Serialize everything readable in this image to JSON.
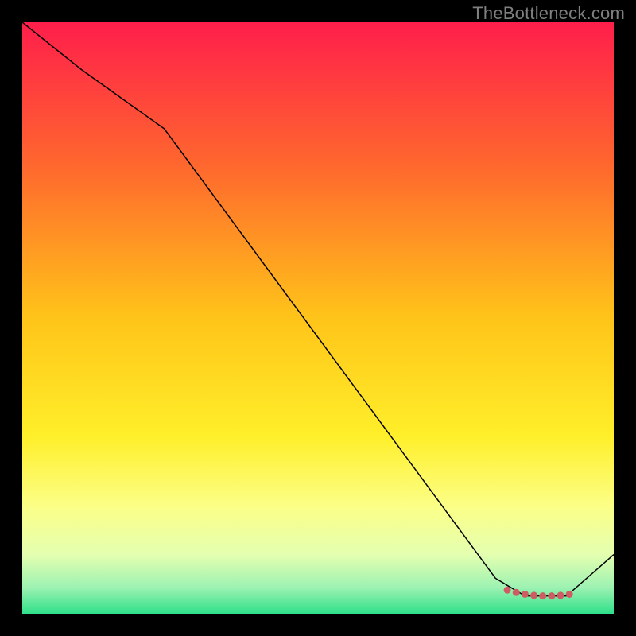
{
  "watermark": "TheBottleneck.com",
  "chart_data": {
    "type": "line",
    "title": "",
    "xlabel": "",
    "ylabel": "",
    "xlim": [
      0,
      100
    ],
    "ylim": [
      0,
      100
    ],
    "background_gradient": {
      "stops": [
        {
          "offset": 0.0,
          "color": "#ff1e4b"
        },
        {
          "offset": 0.25,
          "color": "#ff6a2d"
        },
        {
          "offset": 0.5,
          "color": "#ffc419"
        },
        {
          "offset": 0.7,
          "color": "#ffef2a"
        },
        {
          "offset": 0.82,
          "color": "#fbff88"
        },
        {
          "offset": 0.9,
          "color": "#e4ffb0"
        },
        {
          "offset": 0.955,
          "color": "#9ef2b2"
        },
        {
          "offset": 1.0,
          "color": "#2fe08a"
        }
      ]
    },
    "series": [
      {
        "name": "bottleneck-curve",
        "color": "#000000",
        "width": 1.5,
        "x": [
          0,
          10,
          24,
          80,
          85,
          88,
          92,
          100
        ],
        "y": [
          100,
          92,
          82,
          6,
          3,
          3,
          3,
          10
        ]
      }
    ],
    "markers": {
      "name": "highlight-band",
      "color": "#cf5b63",
      "radius": 4.5,
      "x": [
        82,
        83.5,
        85,
        86.5,
        88,
        89.5,
        91,
        92.5
      ],
      "y": [
        4.0,
        3.6,
        3.3,
        3.1,
        3.0,
        3.0,
        3.1,
        3.3
      ]
    }
  }
}
